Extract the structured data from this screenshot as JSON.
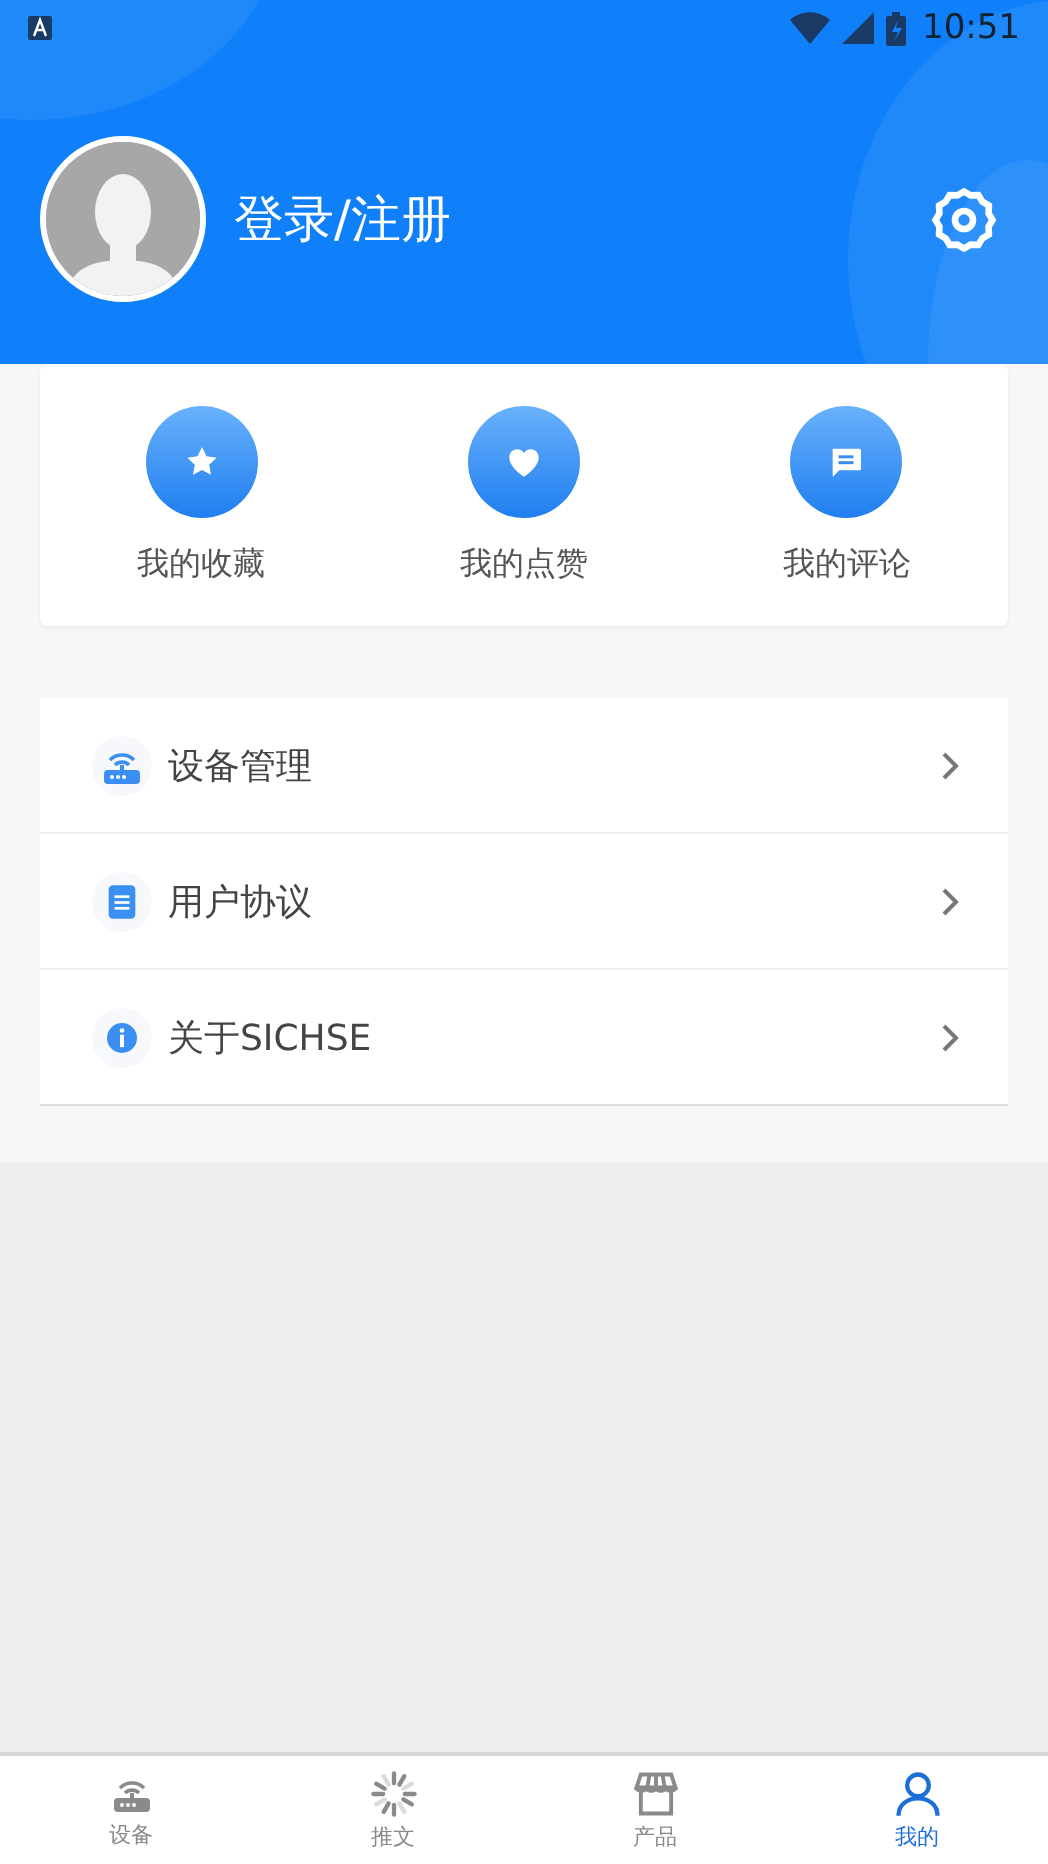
{
  "status_bar": {
    "time": "10:51"
  },
  "profile": {
    "login_label": "登录/注册"
  },
  "shortcuts": [
    {
      "kind": "star",
      "label": "我的收藏"
    },
    {
      "kind": "heart",
      "label": "我的点赞"
    },
    {
      "kind": "comment",
      "label": "我的评论"
    }
  ],
  "menu": [
    {
      "kind": "router",
      "label": "设备管理"
    },
    {
      "kind": "document",
      "label": "用户协议"
    },
    {
      "kind": "info",
      "label": "关于SICHSE"
    }
  ],
  "tabs": [
    {
      "kind": "router",
      "label": "设备",
      "selected": false
    },
    {
      "kind": "loading",
      "label": "推文",
      "selected": false
    },
    {
      "kind": "shop",
      "label": "产品",
      "selected": false
    },
    {
      "kind": "person",
      "label": "我的",
      "selected": true
    }
  ]
}
